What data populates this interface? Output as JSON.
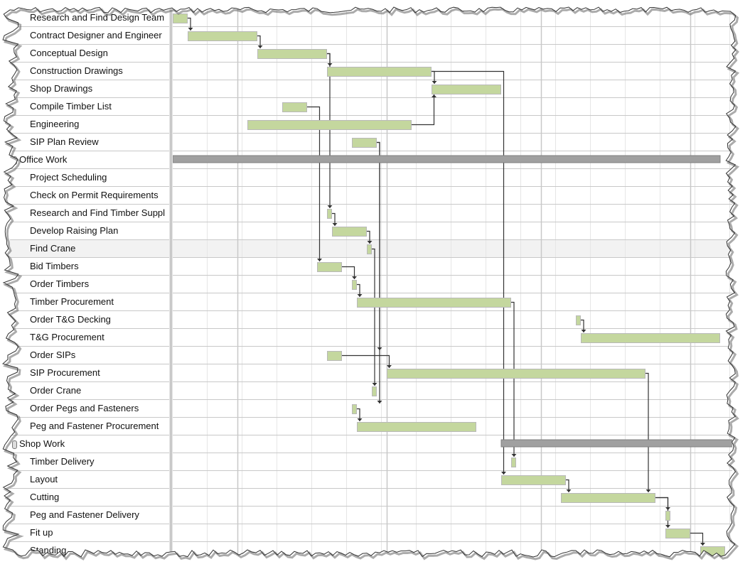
{
  "chart_data": {
    "type": "gantt",
    "title": "",
    "time_unit": "days",
    "week_gridlines": true,
    "month_gridlines_at_days": [
      13,
      43,
      74,
      104
    ],
    "x_range_days": [
      0,
      112
    ],
    "colors": {
      "task_bar": "#c4d79e",
      "task_bar_border": "#b9b9b9",
      "summary_bar": "#a0a0a0",
      "link": "#333333",
      "grid": "#c8c8c8",
      "grid_light": "#e6e6e6"
    },
    "tasks": [
      {
        "name": "Research and Find Design Team",
        "start": 0,
        "duration": 3,
        "summary": false
      },
      {
        "name": "Contract Designer and Engineer",
        "start": 3,
        "duration": 14,
        "summary": false
      },
      {
        "name": "Conceptual Design",
        "start": 17,
        "duration": 14,
        "summary": false
      },
      {
        "name": "Construction Drawings",
        "start": 31,
        "duration": 21,
        "summary": false
      },
      {
        "name": "Shop Drawings",
        "start": 52,
        "duration": 14,
        "summary": false
      },
      {
        "name": "Compile Timber List",
        "start": 22,
        "duration": 5,
        "summary": false
      },
      {
        "name": "Engineering",
        "start": 15,
        "duration": 33,
        "summary": false
      },
      {
        "name": "SIP Plan Review",
        "start": 36,
        "duration": 5,
        "summary": false
      },
      {
        "name": "Office Work",
        "start": 0,
        "duration": 110,
        "summary": true
      },
      {
        "name": "Project Scheduling",
        "start": null,
        "duration": null,
        "summary": false
      },
      {
        "name": "Check on Permit Requirements",
        "start": null,
        "duration": null,
        "summary": false
      },
      {
        "name": "Research and Find Timber Suppl",
        "start": 31,
        "duration": 1,
        "summary": false
      },
      {
        "name": "Develop Raising Plan",
        "start": 32,
        "duration": 7,
        "summary": false
      },
      {
        "name": "Find Crane",
        "start": 39,
        "duration": 1,
        "summary": false,
        "selected": true
      },
      {
        "name": "Bid Timbers",
        "start": 29,
        "duration": 5,
        "summary": false
      },
      {
        "name": "Order Timbers",
        "start": 36,
        "duration": 1,
        "summary": false
      },
      {
        "name": "Timber Procurement",
        "start": 37,
        "duration": 31,
        "summary": false
      },
      {
        "name": "Order T&G Decking",
        "start": 81,
        "duration": 1,
        "summary": false
      },
      {
        "name": "T&G Procurement",
        "start": 82,
        "duration": 28,
        "summary": false
      },
      {
        "name": "Order SIPs",
        "start": 31,
        "duration": 3,
        "summary": false
      },
      {
        "name": "SIP Procurement",
        "start": 43,
        "duration": 52,
        "summary": false
      },
      {
        "name": "Order Crane",
        "start": 40,
        "duration": 1,
        "summary": false
      },
      {
        "name": "Order Pegs and Fasteners",
        "start": 36,
        "duration": 1,
        "summary": false
      },
      {
        "name": "Peg and Fastener Procurement",
        "start": 37,
        "duration": 24,
        "summary": false
      },
      {
        "name": "Shop Work",
        "start": 66,
        "duration": 47,
        "summary": true
      },
      {
        "name": "Timber Delivery",
        "start": 68,
        "duration": 1,
        "summary": false
      },
      {
        "name": "Layout",
        "start": 66,
        "duration": 13,
        "summary": false
      },
      {
        "name": "Cutting",
        "start": 78,
        "duration": 19,
        "summary": false
      },
      {
        "name": "Peg and Fastener Delivery",
        "start": 99,
        "duration": 1,
        "summary": false
      },
      {
        "name": "Fit up",
        "start": 99,
        "duration": 5,
        "summary": false
      },
      {
        "name": "Standing",
        "start": 106,
        "duration": 5,
        "summary": false
      }
    ],
    "links": [
      [
        0,
        1
      ],
      [
        1,
        2
      ],
      [
        2,
        3
      ],
      [
        3,
        4
      ],
      [
        6,
        4
      ],
      [
        5,
        14
      ],
      [
        2,
        11
      ],
      [
        11,
        12
      ],
      [
        12,
        13
      ],
      [
        14,
        15
      ],
      [
        7,
        22
      ],
      [
        7,
        19
      ],
      [
        15,
        16
      ],
      [
        17,
        18
      ],
      [
        19,
        20
      ],
      [
        13,
        21
      ],
      [
        22,
        23
      ],
      [
        16,
        25
      ],
      [
        20,
        27
      ],
      [
        3,
        26
      ],
      [
        26,
        27
      ],
      [
        27,
        29
      ],
      [
        27,
        28
      ],
      [
        29,
        30
      ]
    ]
  }
}
